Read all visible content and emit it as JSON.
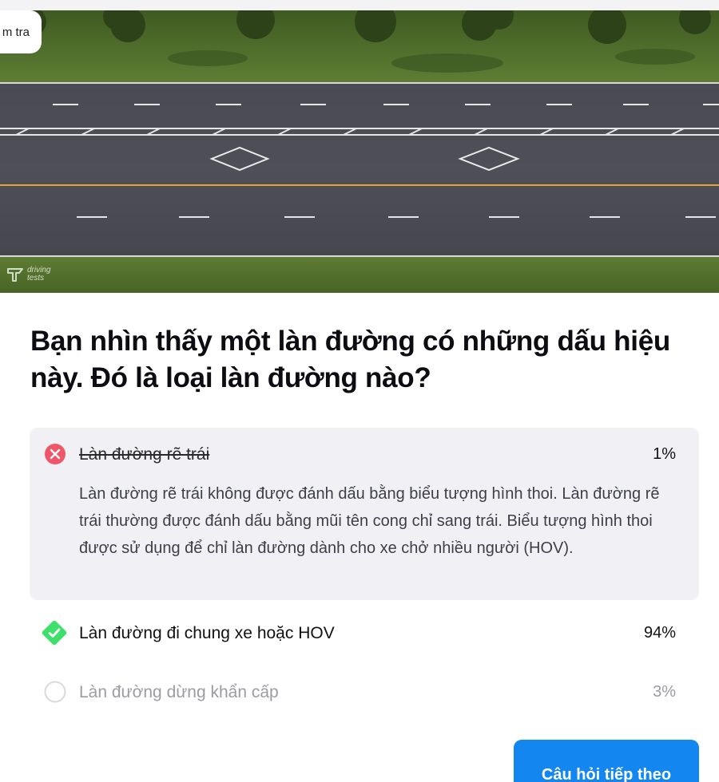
{
  "top_tab": {
    "label": "m tra"
  },
  "scene": {
    "watermark_line1": "driving",
    "watermark_line2": "tests"
  },
  "question": {
    "text": "Bạn nhìn thấy một làn đường có những dấu hiệu này. Đó là loại làn đường nào?"
  },
  "options": [
    {
      "label": "Làn đường rẽ trái",
      "percent": "1%",
      "state": "incorrect",
      "icon": "x-circle-icon",
      "explanation": "Làn đường rẽ trái không được đánh dấu bằng biểu tượng hình thoi. Làn đường rẽ trái thường được đánh dấu bằng mũi tên cong chỉ sang trái. Biểu tượng hình thoi được sử dụng để chỉ làn đường dành cho xe chở nhiều người (HOV)."
    },
    {
      "label": "Làn đường đi chung xe hoặc HOV",
      "percent": "94%",
      "state": "correct",
      "icon": "check-diamond-icon"
    },
    {
      "label": "Làn đường dừng khẩn cấp",
      "percent": "3%",
      "state": "unselected",
      "icon": "empty-circle-icon"
    }
  ],
  "next_button": {
    "label": "Câu hỏi tiếp theo"
  },
  "colors": {
    "primary": "#1486f0",
    "incorrect": "#f0566a",
    "correct": "#3ee06b",
    "road_center_line": "#e8a23a"
  }
}
